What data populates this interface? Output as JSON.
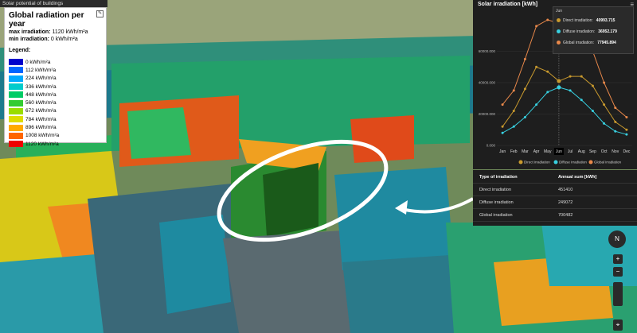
{
  "panel": {
    "header": "Solar potential of buildings",
    "title": "Global radiation per year",
    "max_label": "max irradiation:",
    "max_value": "1120 kWh/m²a",
    "min_label": "min irradiation:",
    "min_value": "0 kWh/m²a",
    "legend_label": "Legend:",
    "legend": [
      {
        "label": "0 kWh/m²a",
        "color": "#0000cc"
      },
      {
        "label": "112 kWh/m²a",
        "color": "#0066ff"
      },
      {
        "label": "224 kWh/m²a",
        "color": "#00aaff"
      },
      {
        "label": "336 kWh/m²a",
        "color": "#00cccc"
      },
      {
        "label": "448 kWh/m²a",
        "color": "#00cc66"
      },
      {
        "label": "560 kWh/m²a",
        "color": "#33cc33"
      },
      {
        "label": "672 kWh/m²a",
        "color": "#99dd00"
      },
      {
        "label": "784 kWh/m²a",
        "color": "#dddd00"
      },
      {
        "label": "896 kWh/m²a",
        "color": "#ffaa00"
      },
      {
        "label": "1008 kWh/m²a",
        "color": "#ff6600"
      },
      {
        "label": "1120 kWh/m²a",
        "color": "#ee0000"
      }
    ]
  },
  "chart_panel": {
    "title": "Solar irradiation [kWh]",
    "menu_icon": "hamburger-icon"
  },
  "tooltip": {
    "month": "Jun",
    "rows": [
      {
        "name": "Direct irradiation:",
        "value": "40993.715",
        "color": "#c99a2e"
      },
      {
        "name": "Diffuse irradiation:",
        "value": "36952.179",
        "color": "#38d0e0"
      },
      {
        "name": "Global irradiation:",
        "value": "77945.894",
        "color": "#e8884a"
      }
    ]
  },
  "chart_data": {
    "type": "line",
    "categories": [
      "Jan",
      "Feb",
      "Mar",
      "Apr",
      "May",
      "Jun",
      "Jul",
      "Aug",
      "Sep",
      "Oct",
      "Nov",
      "Dec"
    ],
    "ylim": [
      0,
      80000
    ],
    "yticks": [
      "0.000",
      "20000.000",
      "40000.000",
      "60000.000"
    ],
    "series": [
      {
        "name": "Direct irradiation",
        "color": "#c99a2e",
        "values": [
          12000,
          22000,
          36000,
          50000,
          47000,
          41000,
          44000,
          44000,
          38000,
          26000,
          15000,
          10000
        ]
      },
      {
        "name": "Diffuse irradiation",
        "color": "#38d0e0",
        "values": [
          8000,
          12000,
          18000,
          26000,
          34000,
          37000,
          35000,
          29000,
          22000,
          14000,
          9000,
          7000
        ]
      },
      {
        "name": "Global irradiation",
        "color": "#e8884a",
        "values": [
          26000,
          35000,
          55000,
          76000,
          80000,
          78000,
          79000,
          72000,
          60000,
          40000,
          24000,
          18000
        ]
      }
    ],
    "highlight": "Jun"
  },
  "table": {
    "headers": [
      "Type of irradiation",
      "Annual sum [kWh]"
    ],
    "rows": [
      [
        "Direct irradiation",
        "451410"
      ],
      [
        "Diffuse irradiation",
        "249072"
      ],
      [
        "Global irradiation",
        "700482"
      ]
    ]
  },
  "controls": {
    "compass": "N",
    "zoom_in": "+",
    "zoom_out": "−",
    "location_icon": "location-pin-icon"
  }
}
